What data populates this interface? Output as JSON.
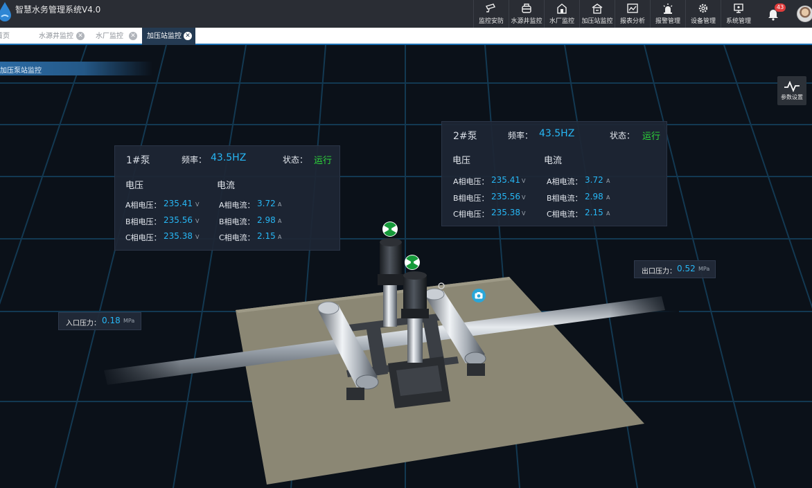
{
  "app": {
    "title": "智慧水务管理系统V4.0"
  },
  "nav": [
    {
      "label": "监控安防",
      "icon": "camera-icon"
    },
    {
      "label": "水源井监控",
      "icon": "well-icon"
    },
    {
      "label": "水厂监控",
      "icon": "plant-icon"
    },
    {
      "label": "加压站监控",
      "icon": "station-icon"
    },
    {
      "label": "报表分析",
      "icon": "chart-icon"
    },
    {
      "label": "报警管理",
      "icon": "alarm-icon"
    },
    {
      "label": "设备管理",
      "icon": "gear-icon"
    },
    {
      "label": "系统管理",
      "icon": "monitor-icon"
    }
  ],
  "notifications": {
    "count": "43"
  },
  "tabs": [
    {
      "label": "首页",
      "closable": false
    },
    {
      "label": "水源井监控",
      "closable": true
    },
    {
      "label": "水厂监控",
      "closable": true
    },
    {
      "label": "加压站监控",
      "closable": true,
      "active": true
    }
  ],
  "section": {
    "title": "加压泵站监控"
  },
  "param_button": {
    "label": "参数设置"
  },
  "pumps": [
    {
      "name": "1#泵",
      "freq_label": "频率：",
      "freq": "43.5HZ",
      "status_label": "状态：",
      "status": "运行",
      "voltage_head": "电压",
      "current_head": "电流",
      "voltage": [
        {
          "label": "A相电压：",
          "value": "235.41",
          "unit": "V"
        },
        {
          "label": "B相电压：",
          "value": "235.56",
          "unit": "V"
        },
        {
          "label": "C相电压：",
          "value": "235.38",
          "unit": "V"
        }
      ],
      "current": [
        {
          "label": "A相电流：",
          "value": "3.72",
          "unit": "A"
        },
        {
          "label": "B相电流：",
          "value": "2.98",
          "unit": "A"
        },
        {
          "label": "C相电流：",
          "value": "2.15",
          "unit": "A"
        }
      ]
    },
    {
      "name": "2#泵",
      "freq_label": "频率：",
      "freq": "43.5HZ",
      "status_label": "状态：",
      "status": "运行",
      "voltage_head": "电压",
      "current_head": "电流",
      "voltage": [
        {
          "label": "A相电压：",
          "value": "235.41",
          "unit": "V"
        },
        {
          "label": "B相电压：",
          "value": "235.56",
          "unit": "V"
        },
        {
          "label": "C相电压：",
          "value": "235.38",
          "unit": "V"
        }
      ],
      "current": [
        {
          "label": "A相电流：",
          "value": "3.72",
          "unit": "A"
        },
        {
          "label": "B相电流：",
          "value": "2.98",
          "unit": "A"
        },
        {
          "label": "C相电流：",
          "value": "2.15",
          "unit": "A"
        }
      ]
    }
  ],
  "pressure": {
    "inlet": {
      "label": "入口压力：",
      "value": "0.18",
      "unit": "MPa"
    },
    "outlet": {
      "label": "出口压力：",
      "value": "0.52",
      "unit": "MPa"
    }
  },
  "colors": {
    "accent": "#27b7f5",
    "running": "#2ed73a",
    "topbar": "#2a2d34",
    "panel": "#1e2634"
  }
}
